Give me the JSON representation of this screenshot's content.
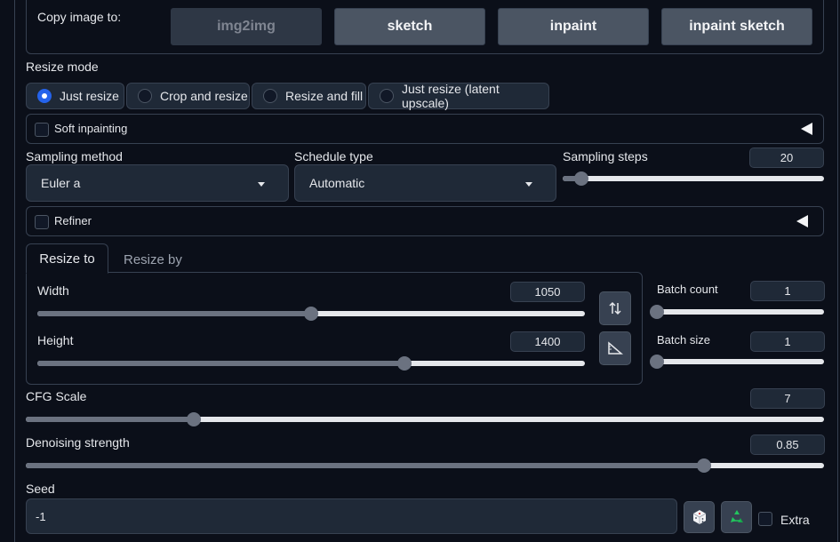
{
  "copy_image": {
    "label": "Copy image to:",
    "buttons": [
      {
        "label": "img2img",
        "disabled": true
      },
      {
        "label": "sketch",
        "disabled": false
      },
      {
        "label": "inpaint",
        "disabled": false
      },
      {
        "label": "inpaint sketch",
        "disabled": false
      }
    ]
  },
  "resize_mode": {
    "label": "Resize mode",
    "options": [
      "Just resize",
      "Crop and resize",
      "Resize and fill",
      "Just resize (latent upscale)"
    ],
    "selected": "Just resize"
  },
  "soft_inpainting": {
    "label": "Soft inpainting",
    "checked": false
  },
  "sampling_method": {
    "label": "Sampling method",
    "value": "Euler a"
  },
  "schedule_type": {
    "label": "Schedule type",
    "value": "Automatic"
  },
  "sampling_steps": {
    "label": "Sampling steps",
    "value": "20",
    "fraction": 0.07
  },
  "refiner": {
    "label": "Refiner",
    "checked": false
  },
  "resize_tabs": {
    "tabs": [
      "Resize to",
      "Resize by"
    ],
    "active": "Resize to"
  },
  "width": {
    "label": "Width",
    "value": "1050",
    "fraction": 0.5
  },
  "height": {
    "label": "Height",
    "value": "1400",
    "fraction": 0.67
  },
  "batch_count": {
    "label": "Batch count",
    "value": "1",
    "fraction": 0.0
  },
  "batch_size": {
    "label": "Batch size",
    "value": "1",
    "fraction": 0.0
  },
  "cfg_scale": {
    "label": "CFG Scale",
    "value": "7",
    "fraction": 0.21
  },
  "denoising": {
    "label": "Denoising strength",
    "value": "0.85",
    "fraction": 0.85
  },
  "seed": {
    "label": "Seed",
    "value": "-1",
    "extra_label": "Extra",
    "extra_checked": false
  },
  "icons": {
    "swap": "swap-dimensions-icon",
    "aspect": "aspect-ratio-icon",
    "dice": "dice-icon",
    "recycle": "recycle-icon"
  },
  "colors": {
    "accent": "#2563eb",
    "background": "#0b0f19",
    "surface": "#1f2937"
  }
}
